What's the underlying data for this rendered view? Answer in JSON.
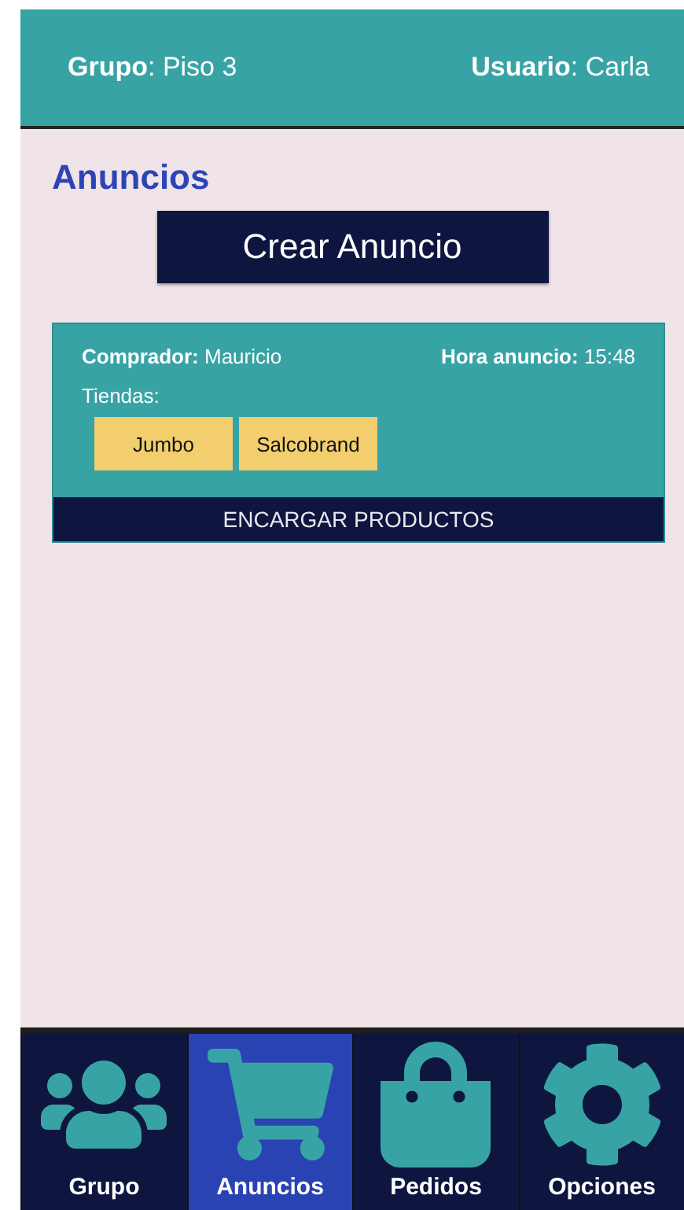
{
  "header": {
    "group": "**Grupo**: Piso 3",
    "user": "**Usuario**: Carla"
  },
  "title": "Anuncios",
  "create_button": "Crear Anuncio",
  "announcements": [
    {
      "buyer": "**Comprador:** Mauricio",
      "time": "**Hora anuncio:** 15:48",
      "stores_label": "Tiendas:",
      "stores": [
        "Jumbo",
        "Salcobrand"
      ],
      "action": "ENCARGAR PRODUCTOS"
    }
  ],
  "nav": [
    {
      "kind": "group",
      "label": "Grupo",
      "selected": false
    },
    {
      "kind": "cart",
      "label": "Anuncios",
      "selected": true
    },
    {
      "kind": "bag",
      "label": "Pedidos",
      "selected": false
    },
    {
      "kind": "gear",
      "label": "Opciones",
      "selected": false
    }
  ]
}
